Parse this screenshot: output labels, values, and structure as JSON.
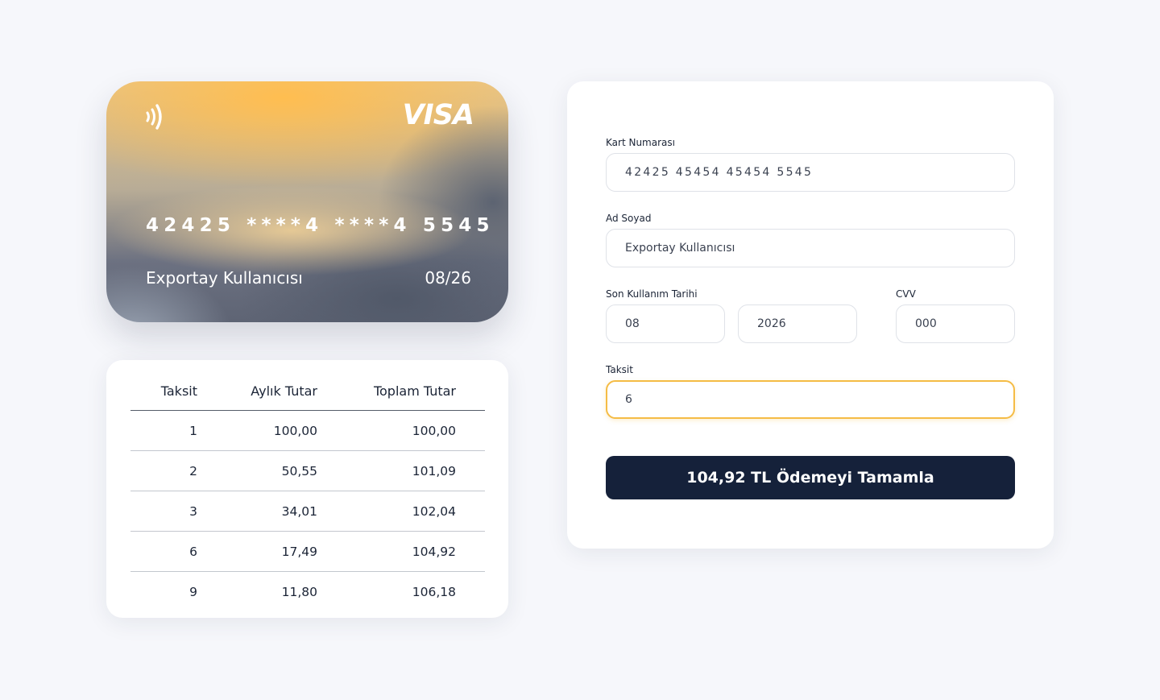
{
  "card": {
    "brand": "VISA",
    "number": "42425 ****4 ****4 5545",
    "holder": "Exportay Kullanıcısı",
    "expiry": "08/26",
    "contactless_icon": "contactless-icon",
    "colors": {
      "amber": "#ffbe50",
      "slate": "#5e6474"
    }
  },
  "installments": {
    "headers": [
      "Taksit",
      "Aylık Tutar",
      "Toplam Tutar"
    ],
    "rows": [
      [
        "1",
        "100,00",
        "100,00"
      ],
      [
        "2",
        "50,55",
        "101,09"
      ],
      [
        "3",
        "34,01",
        "102,04"
      ],
      [
        "6",
        "17,49",
        "104,92"
      ],
      [
        "9",
        "11,80",
        "106,18"
      ]
    ]
  },
  "form": {
    "card_number": {
      "label": "Kart Numarası",
      "value": "42425 45454 45454 5545"
    },
    "name": {
      "label": "Ad Soyad",
      "value": "Exportay Kullanıcısı"
    },
    "expiry": {
      "label": "Son Kullanım Tarihi",
      "month": "08",
      "year": "2026"
    },
    "cvv": {
      "label": "CVV",
      "value": "000"
    },
    "installment": {
      "label": "Taksit",
      "value": "6"
    },
    "submit_label": "104,92 TL Ödemeyi Tamamla"
  },
  "colors": {
    "page_background": "#f6f7fb",
    "button_background": "#15213a",
    "focus_border": "#f5bc45"
  }
}
